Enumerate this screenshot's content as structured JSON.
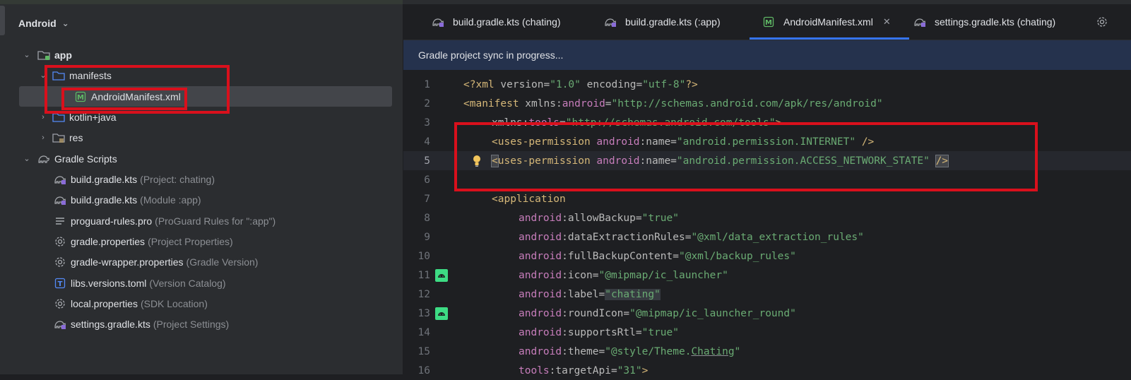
{
  "project": {
    "view_label": "Android",
    "tree": [
      {
        "label": "app",
        "hint": ""
      },
      {
        "label": "manifests",
        "hint": ""
      },
      {
        "label": "AndroidManifest.xml",
        "hint": ""
      },
      {
        "label": "kotlin+java",
        "hint": ""
      },
      {
        "label": "res",
        "hint": ""
      },
      {
        "label": "Gradle Scripts",
        "hint": ""
      },
      {
        "label": "build.gradle.kts",
        "hint": "(Project: chating)"
      },
      {
        "label": "build.gradle.kts",
        "hint": "(Module :app)"
      },
      {
        "label": "proguard-rules.pro",
        "hint": "(ProGuard Rules for \":app\")"
      },
      {
        "label": "gradle.properties",
        "hint": "(Project Properties)"
      },
      {
        "label": "gradle-wrapper.properties",
        "hint": "(Gradle Version)"
      },
      {
        "label": "libs.versions.toml",
        "hint": "(Version Catalog)"
      },
      {
        "label": "local.properties",
        "hint": "(SDK Location)"
      },
      {
        "label": "settings.gradle.kts",
        "hint": "(Project Settings)"
      }
    ]
  },
  "tabs": [
    {
      "label": "build.gradle.kts (chating)"
    },
    {
      "label": "build.gradle.kts (:app)"
    },
    {
      "label": "AndroidManifest.xml",
      "close": "✕"
    },
    {
      "label": "settings.gradle.kts (chating)"
    }
  ],
  "banner": {
    "text": "Gradle project sync in progress..."
  },
  "line_numbers": [
    "1",
    "2",
    "3",
    "4",
    "5",
    "6",
    "7",
    "8",
    "9",
    "10",
    "11",
    "12",
    "13",
    "14",
    "15",
    "16"
  ],
  "colors": {
    "accent": "#3574f0",
    "highlight_box": "#d9101c",
    "banner_bg": "#25324d",
    "xml_tag": "#d5b778",
    "xml_value": "#6aab73",
    "xml_namespace": "#c77dbb"
  },
  "code": {
    "l1": {
      "a": "<?xml",
      "b": " version=",
      "c": "\"1.0\"",
      "d": " encoding=",
      "e": "\"utf-8\"",
      "f": "?>"
    },
    "l2": {
      "a": "<manifest",
      "b": " xmlns:",
      "c": "android",
      "d": "=",
      "e": "\"http://schemas.android.com/apk/res/android\""
    },
    "l3": {
      "a": "xmlns:",
      "b": "tools",
      "c": "=",
      "d": "\"http://schemas.android.com/tools\"",
      "e": ">"
    },
    "l4": {
      "a": "<uses-permission",
      "b": " android",
      "c": ":name=",
      "d": "\"android.permission.INTERNET\"",
      "e": " />"
    },
    "l5": {
      "a": "<",
      "b": "uses-permission",
      "c": " android",
      "d": ":name=",
      "e": "\"android.permission.ACCESS_NETWORK_STATE\"",
      "f": " ",
      "g": "/>"
    },
    "l7": {
      "a": "<application"
    },
    "l8": {
      "ns": "android",
      "attr": ":allowBackup=",
      "val": "\"true\""
    },
    "l9": {
      "ns": "android",
      "attr": ":dataExtractionRules=",
      "val": "\"@xml/data_extraction_rules\""
    },
    "l10": {
      "ns": "android",
      "attr": ":fullBackupContent=",
      "val": "\"@xml/backup_rules\""
    },
    "l11": {
      "ns": "android",
      "attr": ":icon=",
      "val": "\"@mipmap/ic_launcher\""
    },
    "l12": {
      "ns": "android",
      "attr": ":label=",
      "val": "\"chating\""
    },
    "l13": {
      "ns": "android",
      "attr": ":roundIcon=",
      "val": "\"@mipmap/ic_launcher_round\""
    },
    "l14": {
      "ns": "android",
      "attr": ":supportsRtl=",
      "val": "\"true\""
    },
    "l15": {
      "ns": "android",
      "attr": ":theme=",
      "val1": "\"@style/Theme.",
      "val2": "Chating",
      "val3": "\""
    },
    "l16": {
      "ns": "tools",
      "attr": ":targetApi=",
      "val": "\"31\"",
      "end": ">"
    }
  }
}
